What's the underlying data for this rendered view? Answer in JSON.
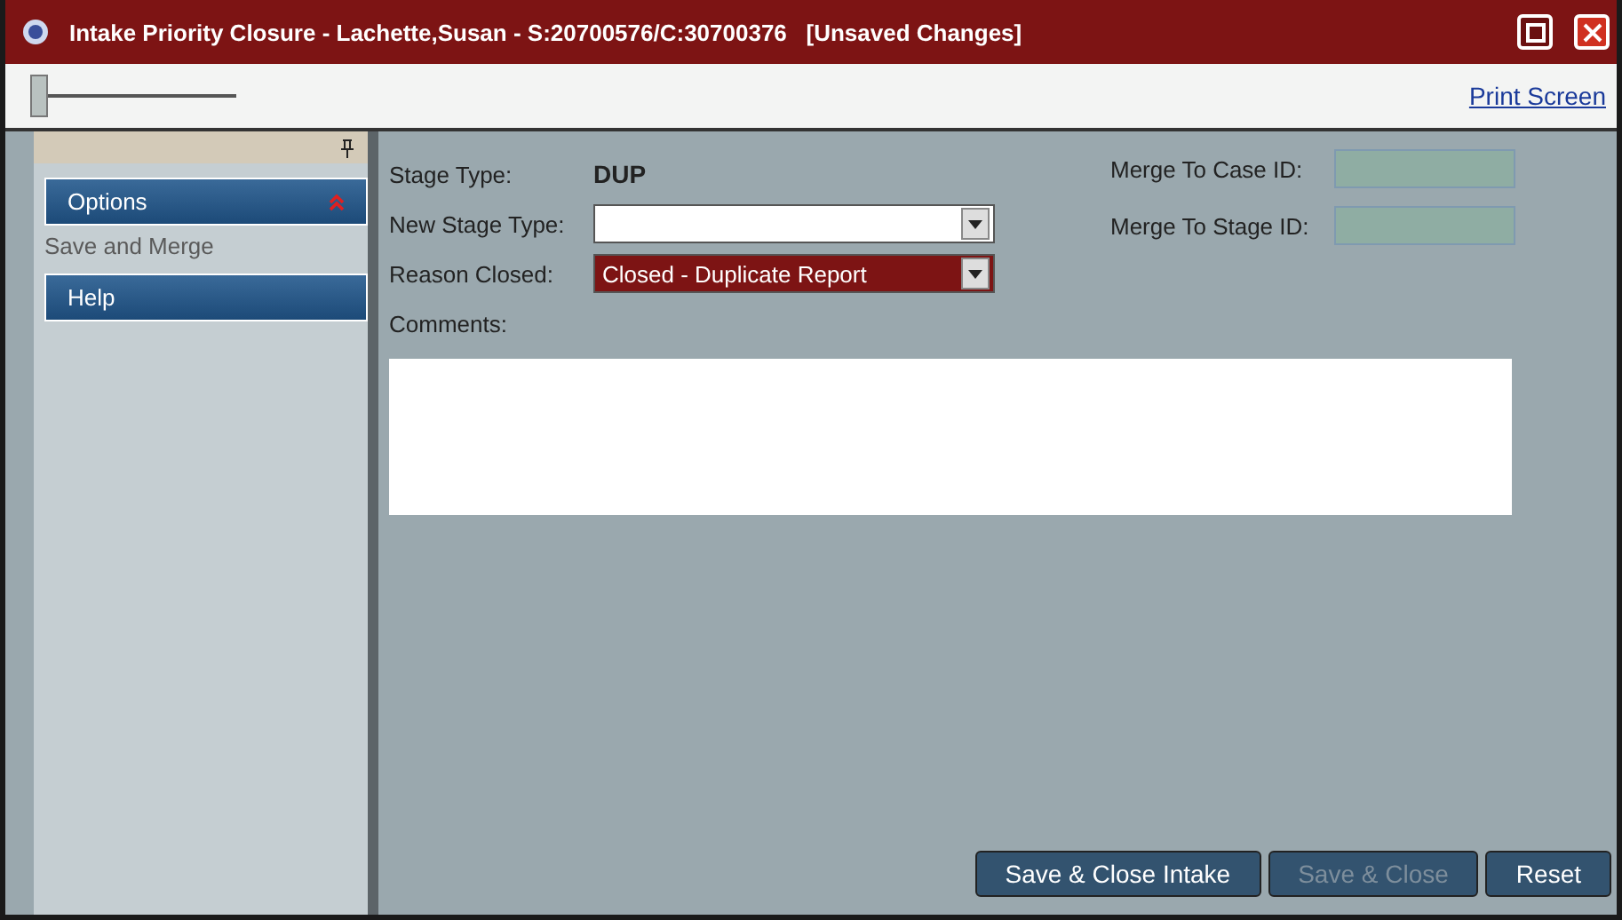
{
  "window": {
    "title": "Intake Priority Closure - Lachette,Susan - S:20700576/C:30700376   [Unsaved Changes]"
  },
  "toolbar": {
    "slider": {
      "level": 0.0
    },
    "link": "Print Screen"
  },
  "sidebar": {
    "sections": [
      {
        "label": "Options",
        "expanded": true,
        "children": [
          {
            "label": "Save and Merge"
          }
        ]
      },
      {
        "label": "Help",
        "expanded": false
      }
    ]
  },
  "form": {
    "stage_type": {
      "label": "Stage Type:",
      "value": "DUP"
    },
    "new_stage_type": {
      "label": "New Stage Type:"
    },
    "reason_closed": {
      "label": "Reason Closed:",
      "value": "Closed - Duplicate Report"
    },
    "merge_case": {
      "label": "Merge To Case ID:",
      "disabled": true
    },
    "merge_stage": {
      "label": "Merge To Stage ID:",
      "disabled": true
    },
    "comments": {
      "label": "Comments:"
    }
  },
  "buttons": [
    {
      "label": "Save & Close Intake",
      "disabled": false
    },
    {
      "label": "Save & Close",
      "disabled": true
    },
    {
      "label": "Reset",
      "disabled": false
    }
  ]
}
